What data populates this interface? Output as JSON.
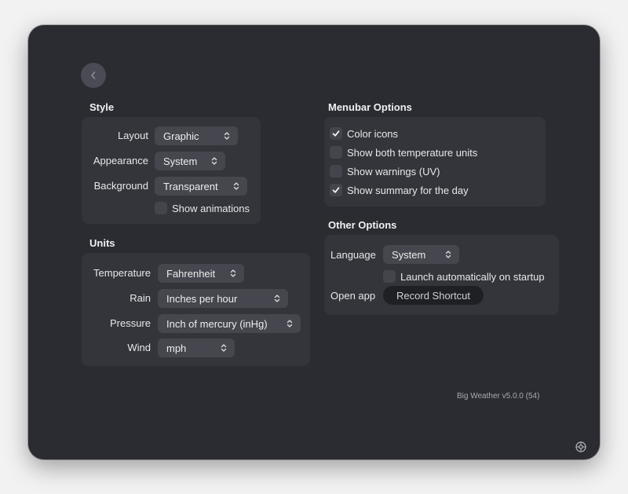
{
  "style": {
    "title": "Style",
    "layout": {
      "label": "Layout",
      "value": "Graphic"
    },
    "appearance": {
      "label": "Appearance",
      "value": "System"
    },
    "background": {
      "label": "Background",
      "value": "Transparent"
    },
    "show_animations": {
      "label": "Show animations",
      "checked": false
    }
  },
  "units": {
    "title": "Units",
    "temperature": {
      "label": "Temperature",
      "value": "Fahrenheit"
    },
    "rain": {
      "label": "Rain",
      "value": "Inches per hour"
    },
    "pressure": {
      "label": "Pressure",
      "value": "Inch of mercury (inHg)"
    },
    "wind": {
      "label": "Wind",
      "value": "mph"
    }
  },
  "menubar": {
    "title": "Menubar Options",
    "options": [
      {
        "label": "Color icons",
        "checked": true
      },
      {
        "label": "Show both temperature units",
        "checked": false
      },
      {
        "label": "Show warnings (UV)",
        "checked": false
      },
      {
        "label": "Show summary for the day",
        "checked": true
      }
    ]
  },
  "other": {
    "title": "Other Options",
    "language": {
      "label": "Language",
      "value": "System"
    },
    "launch": {
      "label": "Launch automatically on startup",
      "checked": false
    },
    "open_app": {
      "label": "Open app",
      "button": "Record Shortcut"
    }
  },
  "footer": {
    "version": "Big Weather v5.0.0 (54)"
  },
  "icons": {
    "back": "chevron-left-icon",
    "select": "up-down-chevron-icon",
    "check": "checkmark-icon",
    "settings": "gear-icon"
  },
  "colors": {
    "window_bg": "#2b2c31",
    "panel_bg": "#34353b",
    "control_bg": "#45464e"
  }
}
